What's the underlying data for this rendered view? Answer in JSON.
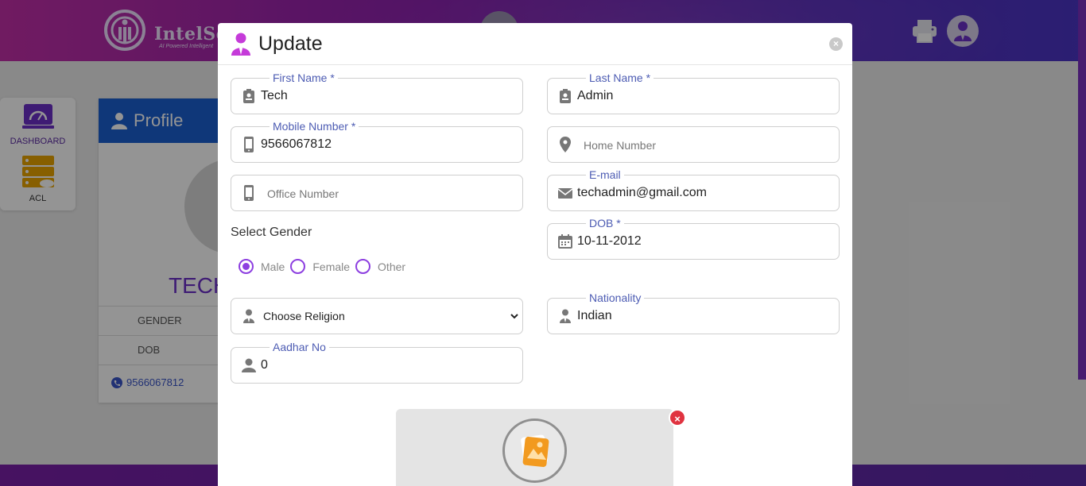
{
  "header": {
    "logo_text": "IntelSch",
    "logo_tagline": "AI Powered Intelligent"
  },
  "sidebar": {
    "items": [
      {
        "label": "DASHBOARD",
        "icon": "dashboard-icon"
      },
      {
        "label": "ACL",
        "icon": "acl-server-icon"
      }
    ]
  },
  "profile": {
    "title": "Profile",
    "name_partial": "TECH",
    "rows": [
      "GENDER",
      "DOB"
    ],
    "phone": "9566067812"
  },
  "modal": {
    "title": "Update",
    "close_icon": "×",
    "fields": {
      "first_name": {
        "label": "First Name *",
        "value": "Tech"
      },
      "last_name": {
        "label": "Last Name *",
        "value": "Admin"
      },
      "mobile": {
        "label": "Mobile Number *",
        "value": "9566067812"
      },
      "home": {
        "placeholder": "Home Number"
      },
      "office": {
        "placeholder": "Office Number"
      },
      "email": {
        "label": "E-mail",
        "value": "techadmin@gmail.com"
      },
      "dob": {
        "label": "DOB *",
        "value": "10-11-2012"
      },
      "religion": {
        "selected": "Choose Religion"
      },
      "nationality": {
        "label": "Nationality",
        "value": "Indian"
      },
      "aadhar": {
        "label": "Aadhar No",
        "value": "0"
      }
    },
    "gender": {
      "title": "Select Gender",
      "options": [
        "Male",
        "Female",
        "Other"
      ],
      "selected": "Male"
    },
    "upload": {
      "close_icon": "×"
    }
  },
  "colors": {
    "accent": "#8d3fe0",
    "label": "#4d5cb3",
    "profile_header": "#1b5fd1",
    "danger": "#e03340"
  }
}
